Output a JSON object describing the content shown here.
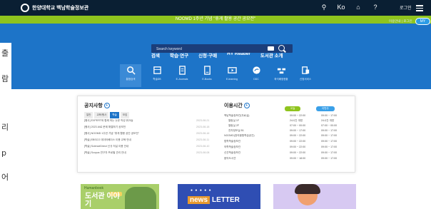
{
  "topbar": {
    "logo_text": "한양대학교 백남학술정보관",
    "user_text": "로그인",
    "icons": [
      "search-icon",
      "ko-lang-icon",
      "home-icon",
      "help-icon",
      "menu-icon"
    ],
    "lang_label": "Ko"
  },
  "notice": {
    "text": "NOOMD 1주년 기념 \"휴게 활용 공간 공모전\""
  },
  "hero": {
    "nav": [
      "검색",
      "학습·연구",
      "신청·구매",
      "HY Reader",
      "도서관 소개"
    ],
    "right_small": "이용안내 | 로그인",
    "right_pill": "MY",
    "search": {
      "placeholder": "Search keyword"
    },
    "quick_links": [
      {
        "label": "통합검색",
        "icon": "search-icon"
      },
      {
        "label": "학술DB",
        "icon": "database-icon"
      },
      {
        "label": "E-Journals",
        "icon": "ejournal-icon"
      },
      {
        "label": "E-Books",
        "icon": "ebook-icon"
      },
      {
        "label": "E-learning",
        "icon": "elearning-icon"
      },
      {
        "label": "DDC",
        "icon": "ddc-icon"
      },
      {
        "label": "좌석배정현황",
        "icon": "seat-icon"
      },
      {
        "label": "신청서비스",
        "icon": "service-icon"
      }
    ]
  },
  "notices": {
    "title": "공지사항",
    "tabs": [
      "일반",
      "교육/행사",
      "학술",
      "모집"
    ],
    "active_tab": "학술",
    "rows": [
      {
        "title": "[행사] EXPERT와 함께 하는 논문 작성 워크숍",
        "date": "2023-08-21"
      },
      {
        "title": "[행사] 2023 AI로 문제 해결하기 공모전",
        "date": "2023-08-18"
      },
      {
        "title": "[행사] NOOMD 1주년 기념 \"휴게 활용 공간 공모전\"",
        "date": "2023-08-16"
      },
      {
        "title": "[학술] EBSCO 데이터베이스 이용 교육 안내",
        "date": "2023-08-11"
      },
      {
        "title": "[학술] ScienceDirect 신규 저널 이용 안내",
        "date": "2023-08-10"
      },
      {
        "title": "[학술] Scopus 연구자 프로필 관리 안내",
        "date": "2023-08-08"
      }
    ]
  },
  "hours": {
    "title": "이용시간",
    "btn_today": "오늘",
    "btn_week": "이번주",
    "rows": [
      {
        "place": "백남학술정보관(자료실)",
        "today": "09:00 ~ 22:00",
        "week": "09:00 ~ 17:00"
      },
      {
        "place": "열람실 1F",
        "today": "24시간 개방",
        "week": "24시간 개방"
      },
      {
        "place": "열람실 2F",
        "today": "07:00 ~ 00:00",
        "week": "07:00 ~ 00:00"
      },
      {
        "place": "전자정보실 B1",
        "today": "09:00 ~ 17:00",
        "week": "09:00 ~ 17:00"
      },
      {
        "place": "NOOMD(창의융합학습공간)",
        "today": "09:00 ~ 22:00",
        "week": "09:00 ~ 17:00"
      },
      {
        "place": "법학학술정보관",
        "today": "09:00 ~ 22:00",
        "week": "09:00 ~ 17:00"
      },
      {
        "place": "의학학술정보관",
        "today": "09:00 ~ 22:00",
        "week": "09:00 ~ 17:00"
      },
      {
        "place": "신관학술정보관",
        "today": "09:00 ~ 22:00",
        "week": "09:00 ~ 17:00"
      },
      {
        "place": "음악도서관",
        "today": "09:00 ~ 18:00",
        "week": "09:00 ~ 17:00"
      }
    ]
  },
  "banners": {
    "b1_title": "Humanbook",
    "b1_main": "도서관 이야기",
    "b2_news": "news",
    "b2_letter": "LETTER",
    "b2_dots": "● ● ● ● ●"
  },
  "left_strip": [
    "출",
    "람",
    "리",
    "p",
    "어"
  ],
  "colors": {
    "topbar": "#0a1f33",
    "notice_bar": "#8fc41e",
    "hero": "#1d74c8",
    "today_btn": "#8fc41e",
    "week_btn": "#3aa0e8"
  }
}
